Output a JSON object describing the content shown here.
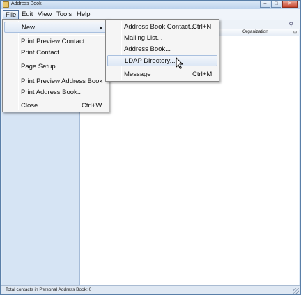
{
  "window": {
    "title": "Address Book",
    "minimize": "–",
    "maximize": "□",
    "close": "✕"
  },
  "menubar": {
    "items": [
      "File",
      "Edit",
      "View",
      "Tools",
      "Help"
    ],
    "active": "File"
  },
  "file_menu": {
    "items": [
      {
        "label": "New",
        "submenu": true
      },
      {
        "label": "Print Preview Contact"
      },
      {
        "label": "Print Contact..."
      },
      {
        "label": "Page Setup..."
      },
      {
        "label": "Print Preview Address Book"
      },
      {
        "label": "Print Address Book..."
      },
      {
        "label": "Close",
        "shortcut": "Ctrl+W"
      }
    ]
  },
  "new_submenu": {
    "items": [
      {
        "label": "Address Book Contact...",
        "shortcut": "Ctrl+N"
      },
      {
        "label": "Mailing List..."
      },
      {
        "label": "Address Book..."
      },
      {
        "label": "LDAP Directory...",
        "highlighted": true
      },
      {
        "label": "Message",
        "shortcut": "Ctrl+M"
      }
    ]
  },
  "table": {
    "column_organization": "Organization"
  },
  "statusbar": {
    "text": "Total contacts in Personal Address Book: 0"
  },
  "icons": {
    "search": "search-icon",
    "column_picker": "column-picker-icon",
    "submenu_arrow": "chevron-right-icon",
    "cursor": "mouse-cursor-icon"
  }
}
